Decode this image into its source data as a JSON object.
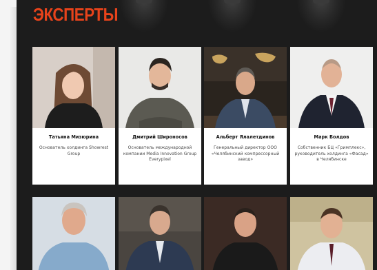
{
  "section": {
    "title": "ЭКСПЕРТЫ"
  },
  "experts_row1": [
    {
      "name": "Татьяна Мизюрина",
      "role": "Основатель холдинга Showrest Group"
    },
    {
      "name": "Дмитрий Широносов",
      "role": "Основатель международной компании Media Innovation Group Everypixel"
    },
    {
      "name": "Альберт Ялалетдинов",
      "role": "Генеральный директор ООО «Челябинский компрессорный завод»"
    },
    {
      "name": "Марк Болдов",
      "role": "Собственник БЦ «Гримплекс», руководитель холдинга «Фасад» в Челябинске"
    }
  ],
  "colors": {
    "accent": "#e8431b",
    "panel": "#1c1c1c",
    "card": "#ffffff"
  }
}
